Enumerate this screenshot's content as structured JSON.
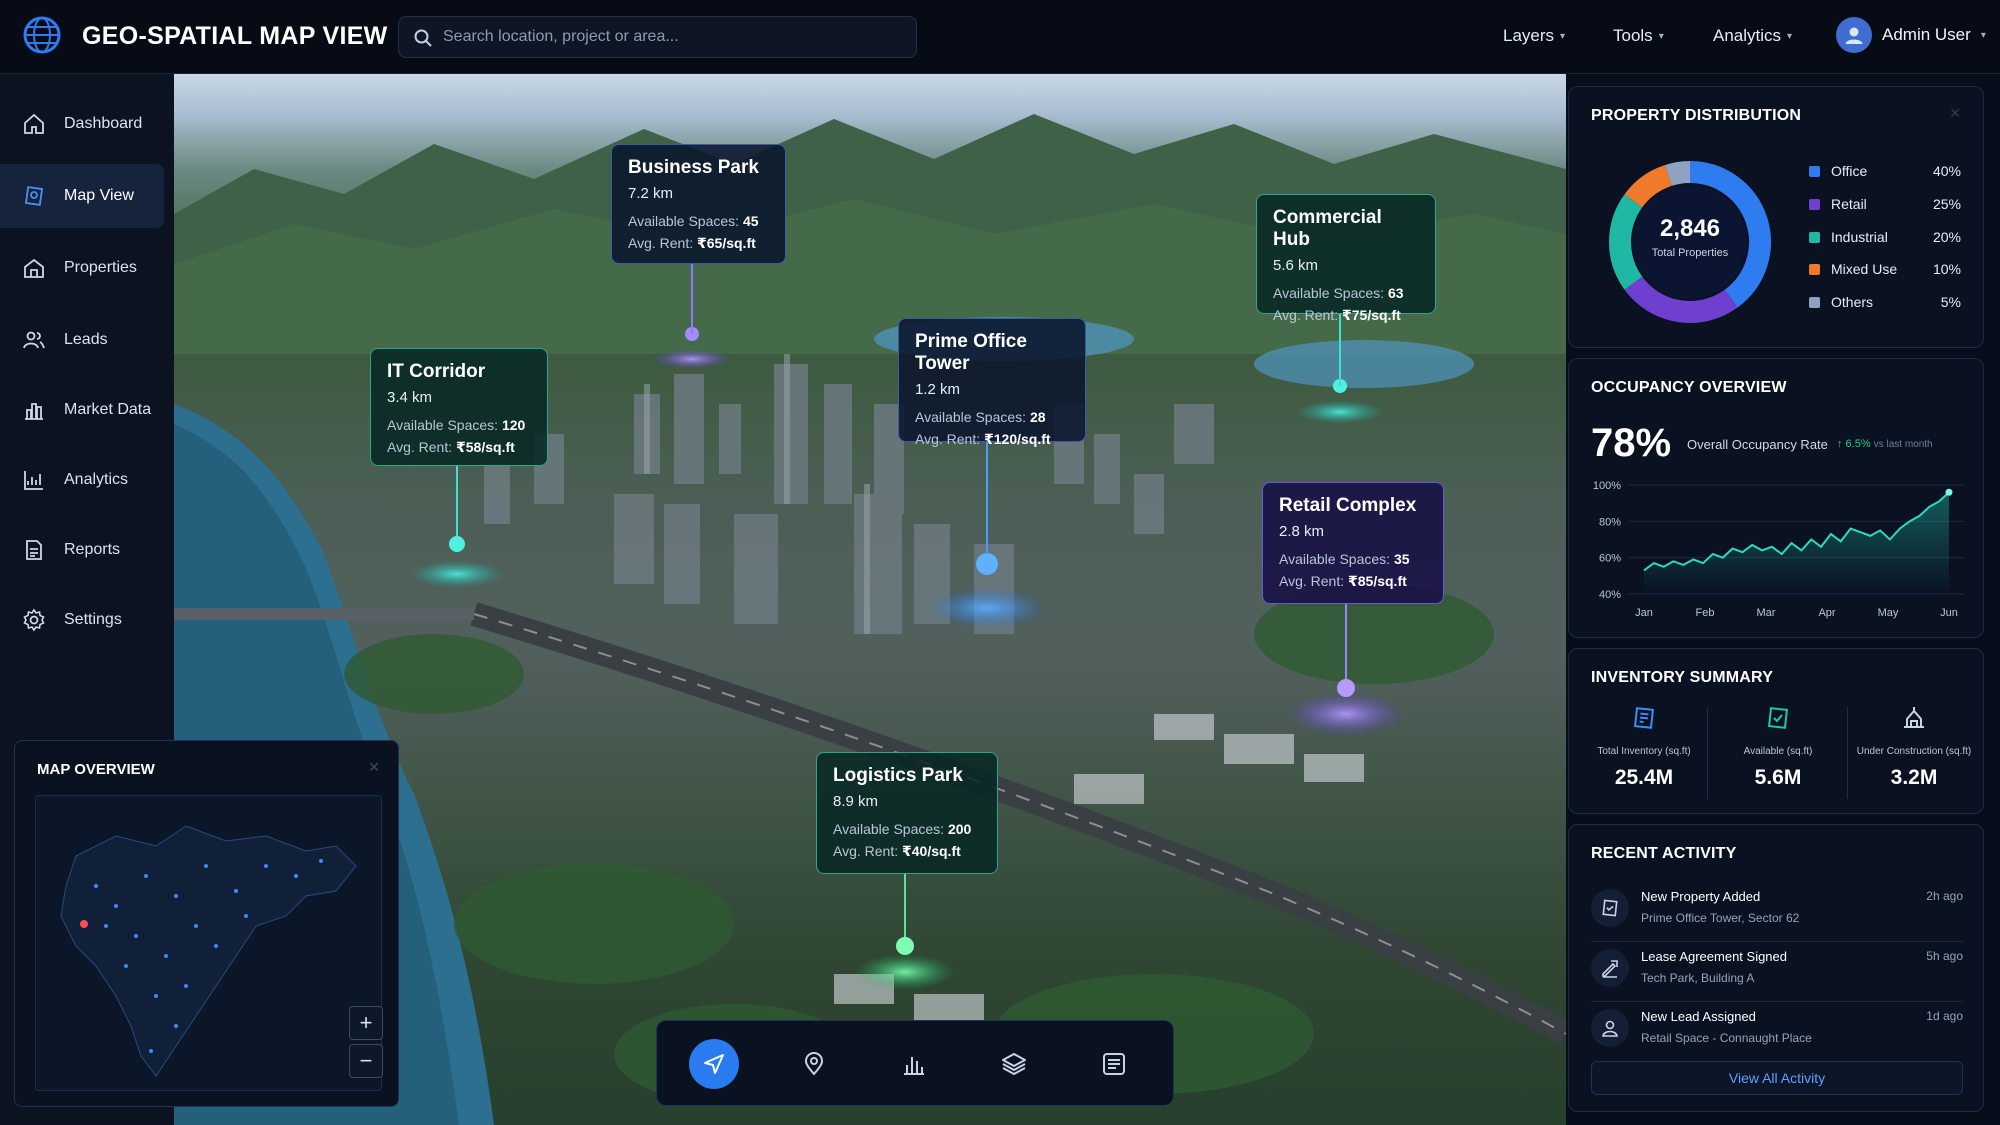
{
  "app": {
    "title": "GEO-SPATIAL MAP VIEW"
  },
  "search": {
    "placeholder": "Search location, project or area..."
  },
  "nav": [
    {
      "label": "Layers"
    },
    {
      "label": "Tools"
    },
    {
      "label": "Analytics"
    }
  ],
  "user": {
    "name": "Admin User"
  },
  "sidebar": {
    "items": [
      {
        "label": "Dashboard",
        "icon": "home-icon"
      },
      {
        "label": "Map View",
        "icon": "map-pin-icon",
        "active": true
      },
      {
        "label": "Properties",
        "icon": "building-icon"
      },
      {
        "label": "Leads",
        "icon": "users-icon"
      },
      {
        "label": "Market Data",
        "icon": "chart-icon"
      },
      {
        "label": "Analytics",
        "icon": "analytics-icon"
      },
      {
        "label": "Reports",
        "icon": "report-icon"
      },
      {
        "label": "Settings",
        "icon": "gear-icon"
      }
    ]
  },
  "markers": [
    {
      "title": "Business Park",
      "distance": "7.2 km",
      "spaces_label": "Available Spaces:",
      "spaces": "45",
      "rent_label": "Avg. Rent:",
      "rent": "₹65/sq.ft"
    },
    {
      "title": "Commercial Hub",
      "distance": "5.6 km",
      "spaces_label": "Available Spaces:",
      "spaces": "63",
      "rent_label": "Avg. Rent:",
      "rent": "₹75/sq.ft"
    },
    {
      "title": "Prime Office Tower",
      "distance": "1.2 km",
      "spaces_label": "Available Spaces:",
      "spaces": "28",
      "rent_label": "Avg. Rent:",
      "rent": "₹120/sq.ft"
    },
    {
      "title": "IT Corridor",
      "distance": "3.4 km",
      "spaces_label": "Available Spaces:",
      "spaces": "120",
      "rent_label": "Avg. Rent:",
      "rent": "₹58/sq.ft"
    },
    {
      "title": "Retail Complex",
      "distance": "2.8 km",
      "spaces_label": "Available Spaces:",
      "spaces": "35",
      "rent_label": "Avg. Rent:",
      "rent": "₹85/sq.ft"
    },
    {
      "title": "Logistics Park",
      "distance": "8.9 km",
      "spaces_label": "Available Spaces:",
      "spaces": "200",
      "rent_label": "Avg. Rent:",
      "rent": "₹40/sq.ft"
    }
  ],
  "overview": {
    "title": "MAP OVERVIEW",
    "zoom_in": "+",
    "zoom_out": "−"
  },
  "property_distribution": {
    "title": "PROPERTY DISTRIBUTION",
    "total": "2,846",
    "total_label": "Total Properties",
    "segments": [
      {
        "label": "Office",
        "percent": "40%",
        "value": 40,
        "color": "#2f7bf0"
      },
      {
        "label": "Retail",
        "percent": "25%",
        "value": 25,
        "color": "#6f3fd0"
      },
      {
        "label": "Industrial",
        "percent": "20%",
        "value": 20,
        "color": "#1fb8a4"
      },
      {
        "label": "Mixed Use",
        "percent": "10%",
        "value": 10,
        "color": "#f07a2a"
      },
      {
        "label": "Others",
        "percent": "5%",
        "value": 5,
        "color": "#8fa3c0"
      }
    ]
  },
  "occupancy": {
    "title": "OCCUPANCY OVERVIEW",
    "rate": "78%",
    "rate_label": "Overall Occupancy Rate",
    "change": "↑ 6.5%",
    "change_note": "vs last month"
  },
  "chart_data": {
    "type": "line",
    "x": [
      "Jan",
      "Feb",
      "Mar",
      "Apr",
      "May",
      "Jun"
    ],
    "yticks": [
      "100%",
      "80%",
      "60%",
      "40%"
    ],
    "ylim": [
      40,
      100
    ],
    "series": [
      {
        "values": [
          53,
          57,
          55,
          58,
          56,
          59,
          57,
          62,
          60,
          65,
          63,
          67,
          64,
          66,
          62,
          68,
          64,
          70,
          66,
          73,
          69,
          76,
          74,
          72,
          75,
          70,
          76,
          80,
          83,
          88,
          91,
          96
        ]
      }
    ]
  },
  "inventory": {
    "title": "INVENTORY SUMMARY",
    "items": [
      {
        "label": "Total Inventory (sq.ft)",
        "value": "25.4M",
        "icon": "building-icon"
      },
      {
        "label": "Available (sq.ft)",
        "value": "5.6M",
        "icon": "check-building-icon"
      },
      {
        "label": "Under Construction (sq.ft)",
        "value": "3.2M",
        "icon": "crane-icon"
      }
    ]
  },
  "activity": {
    "title": "RECENT ACTIVITY",
    "items": [
      {
        "title": "New Property Added",
        "subtitle": "Prime Office Tower, Sector 62",
        "time": "2h ago"
      },
      {
        "title": "Lease Agreement Signed",
        "subtitle": "Tech Park, Building A",
        "time": "5h ago"
      },
      {
        "title": "New Lead Assigned",
        "subtitle": "Retail Space - Connaught Place",
        "time": "1d ago"
      }
    ],
    "view_all": "View All Activity"
  },
  "colors": {
    "accent": "#2a7bef",
    "panel": "#0a1222",
    "positive": "#27c98f"
  }
}
